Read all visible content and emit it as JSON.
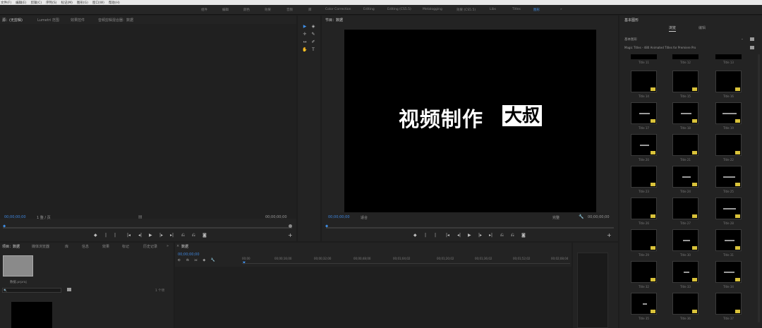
{
  "menu": [
    "文件(F)",
    "编辑(E)",
    "剪辑(C)",
    "序列(S)",
    "标记(M)",
    "图形(G)",
    "窗口(W)",
    "帮助(H)"
  ],
  "workspaces": {
    "items": [
      "组件",
      "编辑",
      "颜色",
      "效果",
      "音频",
      "库",
      "Color Correction",
      "Editing",
      "Editing (CS5.5)",
      "Metalogging",
      "效果 (CS5.5)",
      "Libs",
      "Titles",
      "图形"
    ],
    "active_index": 13,
    "more": "»"
  },
  "source_monitor": {
    "tabs": [
      "源：(无剪辑)",
      "Lumetri 范围",
      "效果控件",
      "音频剪辑混合器：数据"
    ],
    "timecode_left": "00;00;00;00",
    "zoom": "1 整 / 页",
    "timecode_right": "00;00;00;00"
  },
  "tools": {
    "items": [
      "▶",
      "◈",
      "✛",
      "✎",
      "↔",
      "✐",
      "✋",
      "T"
    ]
  },
  "program_monitor": {
    "tab": "节目：数据",
    "timecode_left": "00;00;00;00",
    "fit": "适合",
    "quality": "完整",
    "timecode_right": "00;00;00;00",
    "title_main": "视频制作",
    "title_boxed": "大叔"
  },
  "project_panel": {
    "tabs": [
      "项目：数据",
      "媒体浏览器",
      "库",
      "信息",
      "效果",
      "标记",
      "历史记录"
    ],
    "more": "»",
    "clip_name": "数据.prproj",
    "count": "1 个项",
    "search_placeholder": "🔍"
  },
  "timeline": {
    "tab": "数据",
    "timecode": "00;00;00;00",
    "ruler": [
      "00;00",
      "00;00;16;00",
      "00;00;32;00",
      "00;00;48;00",
      "00;01;04;02",
      "00;01;20;02",
      "00;01;36;02",
      "00;01;52;02",
      "00;02;08;04"
    ]
  },
  "essential_graphics": {
    "title": "基本图形",
    "tab_browse": "浏览",
    "tab_edit": "编辑",
    "folder": "基本图形",
    "collection": "Magic Titles - 480 Animated Titles for Premiere Pro",
    "rows": [
      [
        "Title 11",
        "Title 12",
        "Title 13"
      ],
      [
        "Title 14",
        "Title 15",
        "Title 16"
      ],
      [
        "Title 17",
        "Title 18",
        "Title 19"
      ],
      [
        "Title 20",
        "Title 21",
        "Title 22"
      ],
      [
        "Title 23",
        "Title 24",
        "Title 25"
      ],
      [
        "Title 26",
        "Title 27",
        "Title 28"
      ],
      [
        "Title 29",
        "Title 30",
        "Title 31"
      ],
      [
        "Title 32",
        "Title 33",
        "Title 34"
      ],
      [
        "Title 35",
        "Title 36",
        "Title 37"
      ]
    ]
  },
  "colors": {
    "accent": "#3f8fe8",
    "badge": "#d9c23a",
    "panel": "#232323"
  }
}
